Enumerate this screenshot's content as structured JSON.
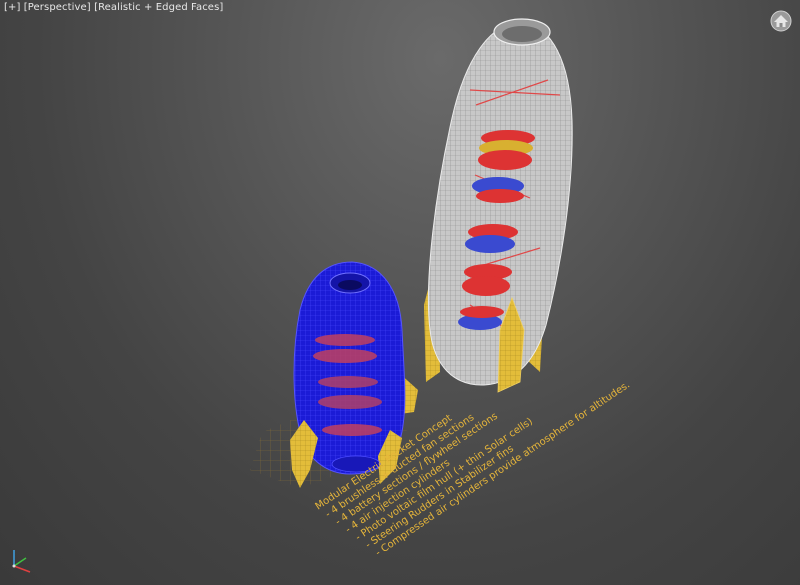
{
  "viewport": {
    "label_plus": "[+]",
    "label_view": "[Perspective]",
    "label_shading": "[Realistic + Edged Faces]"
  },
  "icons": {
    "viewcube": "home-viewcube-icon",
    "axis_gizmo": "axis-tripod-icon"
  },
  "annotation": {
    "lines": [
      "Modular Electric Rocket Concept",
      "- 4 brushless + ducted fan sections",
      "- 4 battery sections / flywheel sections",
      "- 4 air injection cylinders",
      "- Photo voltaic film hull (+ thin Solar cells)",
      "- Steering Rudders in Stabilizer fins",
      "- Compressed air cylinders provide atmosphere for altitudes."
    ]
  },
  "colors": {
    "background": "#4a4a4a",
    "wire_white": "#d8d8d8",
    "blue_body": "#1a1ad8",
    "fin_yellow": "#e8c440",
    "text_yellow": "#e8b838",
    "band_red": "#d83a3a",
    "band_blue": "#3a4ad0"
  }
}
